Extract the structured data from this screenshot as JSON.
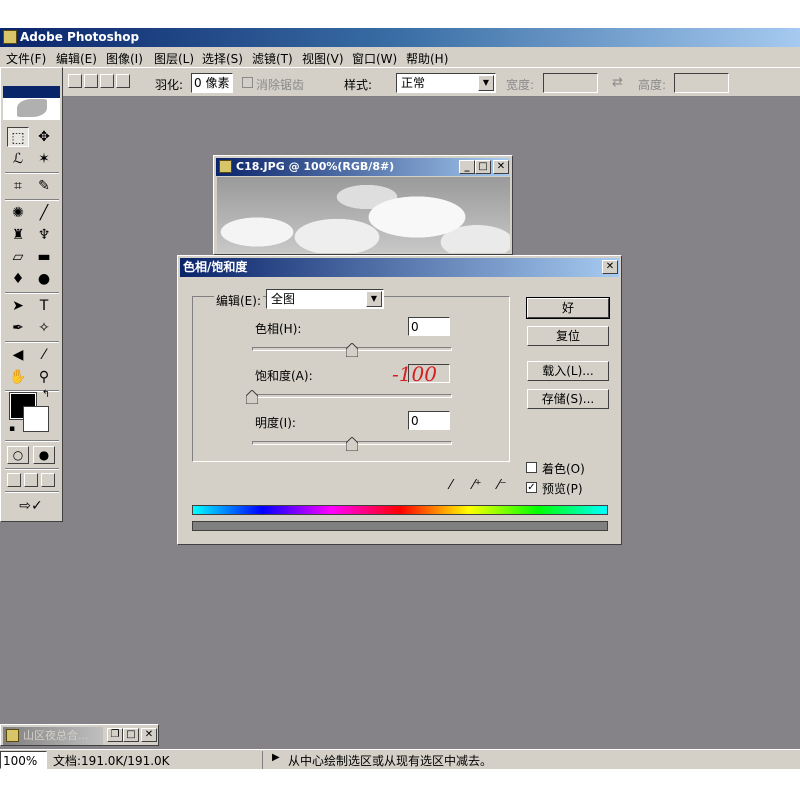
{
  "app": {
    "title": "Adobe Photoshop"
  },
  "menu": [
    "文件(F)",
    "编辑(E)",
    "图像(I)",
    "图层(L)",
    "选择(S)",
    "滤镜(T)",
    "视图(V)",
    "窗口(W)",
    "帮助(H)"
  ],
  "options": {
    "feather_label": "羽化:",
    "feather_value": "0 像素",
    "antialias_label": "消除锯齿",
    "style_label": "样式:",
    "style_value": "正常",
    "width_label": "宽度:",
    "height_label": "高度:"
  },
  "document": {
    "title": "C18.JPG @ 100%(RGB/8#)"
  },
  "dialog": {
    "title": "色相/饱和度",
    "edit_label": "编辑(E):",
    "edit_value": "全图",
    "hue_label": "色相(H):",
    "hue_value": "0",
    "saturation_label": "饱和度(A):",
    "saturation_annotation": "-100",
    "lightness_label": "明度(I):",
    "lightness_value": "0",
    "ok_label": "好",
    "reset_label": "复位",
    "load_label": "载入(L)...",
    "save_label": "存储(S)...",
    "colorize_label": "着色(O)",
    "colorize_checked": false,
    "preview_label": "预览(P)",
    "preview_checked": true,
    "hue_level": 0.5,
    "saturation_level": 0.0,
    "lightness_level": 0.5
  },
  "minimized_window": {
    "title": "山区夜总合..."
  },
  "status": {
    "zoom": "100%",
    "doc_info": "文档:191.0K/191.0K",
    "hint": "从中心绘制选区或从现有选区中减去。"
  },
  "colors": {
    "workspace": "#858288",
    "title_bar": "#0a246a",
    "chrome": "#d4d0c8",
    "annotation": "#d42020"
  }
}
